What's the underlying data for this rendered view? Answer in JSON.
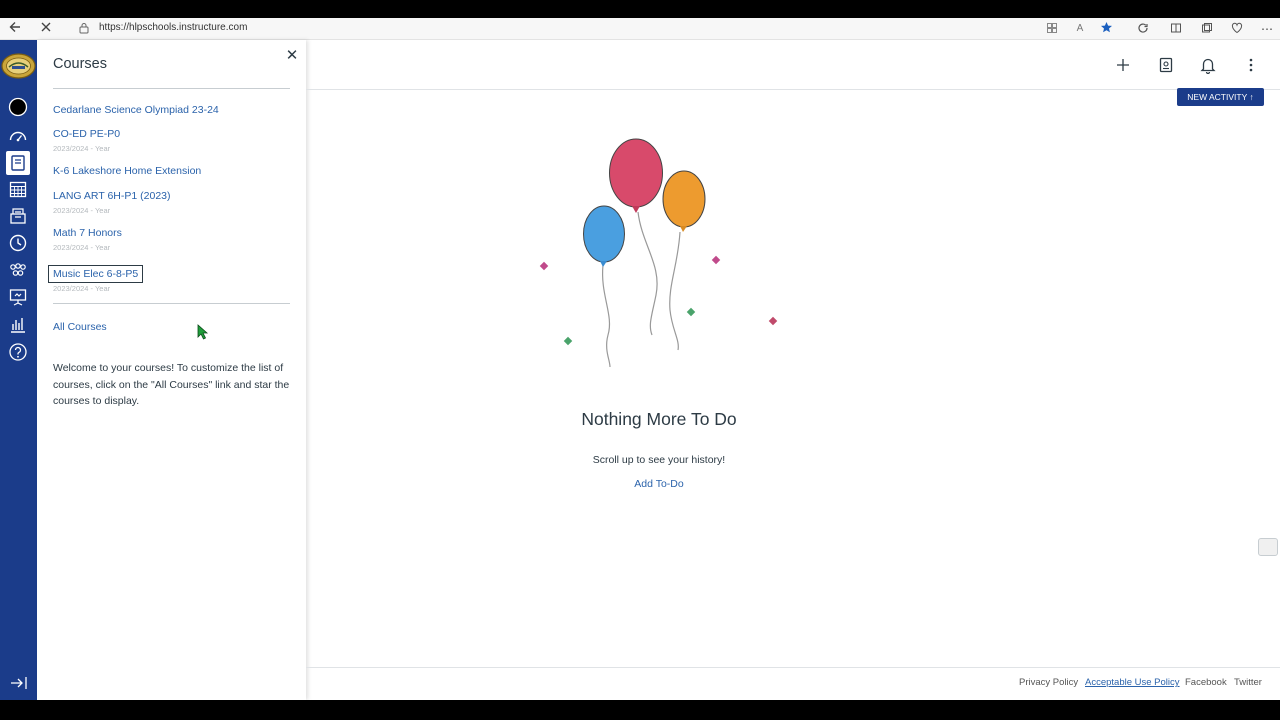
{
  "browser": {
    "url": "https://hlpschools.instructure.com"
  },
  "tray": {
    "title": "Courses",
    "courses": [
      {
        "name": "Cedarlane Science Olympiad 23-24",
        "term": ""
      },
      {
        "name": "CO-ED PE-P0",
        "term": "2023/2024 - Year"
      },
      {
        "name": "K-6 Lakeshore Home Extension",
        "term": ""
      },
      {
        "name": "LANG ART 6H-P1 (2023)",
        "term": "2023/2024 - Year"
      },
      {
        "name": "Math 7 Honors",
        "term": "2023/2024 - Year"
      },
      {
        "name": "Music Elec 6-8-P5",
        "term": "2023/2024 - Year"
      }
    ],
    "all_courses": "All Courses",
    "welcome": "Welcome to your courses! To customize the list of courses, click on the \"All Courses\" link and star the courses to display."
  },
  "main": {
    "new_activity": "NEW ACTIVITY ↑",
    "empty_title": "Nothing More To Do",
    "empty_subtitle": "Scroll up to see your history!",
    "add_todo": "Add To-Do"
  },
  "footer": {
    "links": [
      "Privacy Policy",
      "Acceptable Use Policy",
      "Facebook",
      "Twitter"
    ]
  },
  "colors": {
    "nav": "#1b3c8a",
    "link": "#2b63ab",
    "balloon_red": "#d84a6b",
    "balloon_blue": "#4a9fe0",
    "balloon_orange": "#ed9b2f"
  }
}
